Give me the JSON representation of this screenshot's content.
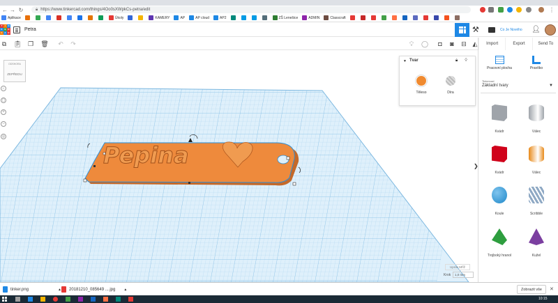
{
  "browser": {
    "url": "https://www.tinkercad.com/things/4Oo0sXWpkCs-petra/edit",
    "bookmarks": [
      {
        "label": "Aplikace",
        "color": "#4285f4"
      },
      {
        "label": "",
        "color": "#e8710a"
      },
      {
        "label": "",
        "color": "#34a853"
      },
      {
        "label": "",
        "color": "#4285f4"
      },
      {
        "label": "",
        "color": "#d93025"
      },
      {
        "label": "",
        "color": "#4285f4"
      },
      {
        "label": "",
        "color": "#1a73e8"
      },
      {
        "label": "",
        "color": "#e37400"
      },
      {
        "label": "",
        "color": "#0f9d58"
      },
      {
        "label": "Úkoly",
        "color": "#e53935"
      },
      {
        "label": "",
        "color": "#3367d6"
      },
      {
        "label": "",
        "color": "#f4b400"
      },
      {
        "label": "KAMERY",
        "color": "#5e35b1"
      },
      {
        "label": "AP",
        "color": "#1e88e5"
      },
      {
        "label": "AP cloud",
        "color": "#1e88e5"
      },
      {
        "label": "AP2",
        "color": "#1e88e5"
      },
      {
        "label": "",
        "color": "#00897b"
      },
      {
        "label": "",
        "color": "#039be5"
      },
      {
        "label": "",
        "color": "#039be5"
      },
      {
        "label": "",
        "color": "#546e7a"
      },
      {
        "label": "ZŠ Lenešice",
        "color": "#2e7d32"
      },
      {
        "label": "ADMIN",
        "color": "#8e24aa"
      },
      {
        "label": "Classcraft",
        "color": "#6d4c41"
      },
      {
        "label": "",
        "color": "#e53935"
      },
      {
        "label": "",
        "color": "#c62828"
      },
      {
        "label": "",
        "color": "#e53935"
      },
      {
        "label": "",
        "color": "#43a047"
      },
      {
        "label": "",
        "color": "#ff7043"
      },
      {
        "label": "",
        "color": "#1565c0"
      },
      {
        "label": "",
        "color": "#5c6bc0"
      },
      {
        "label": "",
        "color": "#e53935"
      },
      {
        "label": "",
        "color": "#3949ab"
      },
      {
        "label": "",
        "color": "#f4511e"
      },
      {
        "label": "",
        "color": "#8d6e63"
      }
    ]
  },
  "header": {
    "project_title": "Petra",
    "user_label": "Co Je Nového"
  },
  "right_panel": {
    "actions": [
      "Import",
      "Export",
      "Send To"
    ],
    "workplane_label": "Pracovní plocha",
    "ruler_label": "Pravítko",
    "library_small": "Tinkercad",
    "library_name": "Základní tvary",
    "shapes": [
      {
        "label": "Kvádr",
        "icon": "gray-box-icon",
        "color": "#9fa4aa"
      },
      {
        "label": "Válec",
        "icon": "gray-cylinder-icon",
        "color": "#9fa4aa"
      },
      {
        "label": "Kvádr",
        "icon": "red-box-icon",
        "color": "#d0021b"
      },
      {
        "label": "Válec",
        "icon": "orange-cylinder-icon",
        "color": "#e88a1a"
      },
      {
        "label": "Koule",
        "icon": "blue-sphere-icon",
        "color": "#1e88c9"
      },
      {
        "label": "Scribble",
        "icon": "scribble-icon",
        "color": "#8fa9c4"
      },
      {
        "label": "Trojboký hranol",
        "icon": "green-prism-icon",
        "color": "#2e9e3f"
      },
      {
        "label": "Kužel",
        "icon": "purple-cone-icon",
        "color": "#7b3fa0"
      }
    ]
  },
  "shape_panel": {
    "title": "Tvar",
    "solid_label": "Těleso",
    "hole_label": "Díra",
    "solid_color": "#f08a30"
  },
  "model": {
    "text": "Pepina",
    "color": "#ee8a3c"
  },
  "viewcube": {
    "top": "ODSHORA",
    "front": "ZEPŘEDU"
  },
  "grid_controls": {
    "edit_grid": "Uprav Mříž",
    "snap_label": "Krok",
    "snap_value": "1,0 mm"
  },
  "downloads": {
    "items": [
      "tinker.png",
      "20181210_085649 ....jpg"
    ],
    "show_all": "Zobrazit vše"
  },
  "taskbar": {
    "time": "10:15"
  }
}
